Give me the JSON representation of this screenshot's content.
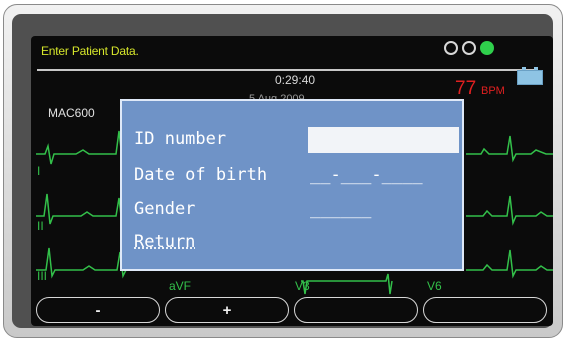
{
  "header": {
    "prompt": "Enter Patient Data.",
    "timer": "0:29:40",
    "date": "5 Aug 2009",
    "heart_rate_value": "77",
    "heart_rate_unit": "BPM",
    "device_name": "MAC600"
  },
  "indicators": [
    {
      "icon": "indicator-circle-icon",
      "state": "off",
      "color": "#d8d8d8"
    },
    {
      "icon": "indicator-circle-icon",
      "state": "off",
      "color": "#d8d8d8"
    },
    {
      "icon": "indicator-circle-icon",
      "state": "on",
      "color": "#2fd04c"
    }
  ],
  "battery_icon": "battery-icon",
  "leads": {
    "row1": "I",
    "row2": "II",
    "row3": "III",
    "avf": "aVF",
    "v3": "V3",
    "v6": "V6"
  },
  "dialog": {
    "id_label": "ID number",
    "id_value": "",
    "dob_label": "Date of birth",
    "dob_value": "__-___-____",
    "gender_label": "Gender",
    "gender_value": "______",
    "return_label": "Return"
  },
  "softkeys": [
    "-",
    "+",
    "",
    ""
  ],
  "colors": {
    "screen_bg": "#0b0b0b",
    "prompt": "#d6e62b",
    "ecg_trace": "#33c04a",
    "heart_rate": "#e02020",
    "dialog_bg": "#6f93c7"
  }
}
